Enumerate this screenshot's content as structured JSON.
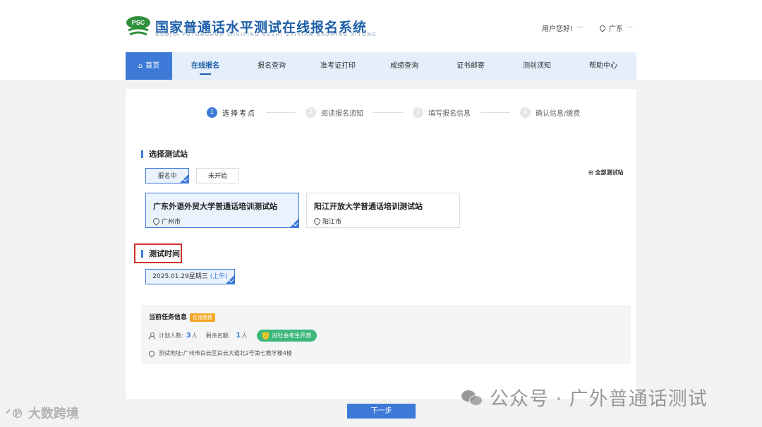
{
  "header": {
    "logo_text": "PSC",
    "title": "国家普通话水平测试在线报名系统",
    "subtitle": "GUOJIA PUTONGHUA SHUIPING CESHI ZAIXIAN BAOMING XITONG",
    "user_greeting": "用户您好!",
    "region": "广东"
  },
  "nav": {
    "items": [
      {
        "label": "首页"
      },
      {
        "label": "在线报名"
      },
      {
        "label": "报名查询"
      },
      {
        "label": "准考证打印"
      },
      {
        "label": "成绩查询"
      },
      {
        "label": "证书邮寄"
      },
      {
        "label": "测前须知"
      },
      {
        "label": "帮助中心"
      }
    ]
  },
  "steps": [
    {
      "num": "1",
      "label": "选择考点"
    },
    {
      "num": "2",
      "label": "阅读报名须知"
    },
    {
      "num": "3",
      "label": "填写报名信息"
    },
    {
      "num": "4",
      "label": "确认信息/缴费"
    }
  ],
  "station_section": {
    "title": "选择测试站",
    "tabs": [
      "报名中",
      "未开始"
    ],
    "all_sites": "全部测试站",
    "stations": [
      {
        "name": "广东外语外贸大学普通话培训测试站",
        "city": "广州市"
      },
      {
        "name": "阳江开放大学普通话培训测试站",
        "city": "阳江市"
      }
    ]
  },
  "time_section": {
    "title": "测试时间",
    "option_date": "2025.01.29星期三",
    "option_half": "(上午)"
  },
  "task_info": {
    "title": "当前任务信息",
    "status_badge": "在线缴费",
    "planned_label": "计划人数:",
    "planned_value": "3",
    "remaining_label": "剩余名额:",
    "remaining_value": "1",
    "person_unit": "人",
    "open_badge": "对社会考生开放",
    "address_label": "测试地址:",
    "address": "广州市白云区白云大道北2号第七教学楼4楼"
  },
  "next_button": "下一步",
  "watermarks": {
    "right": "公众号 · 广外普通话测试",
    "left": "大数跨境"
  }
}
